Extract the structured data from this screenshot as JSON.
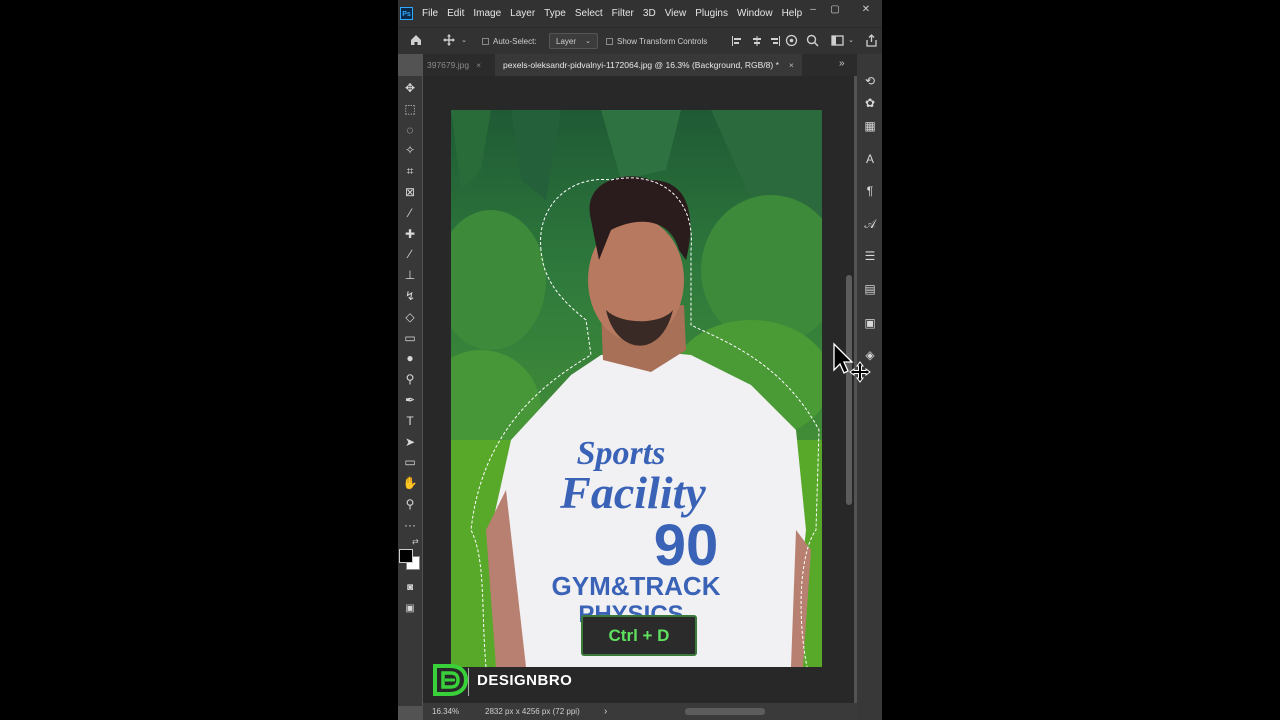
{
  "app": {
    "logo_text": "Ps",
    "menu": [
      "File",
      "Edit",
      "Image",
      "Layer",
      "Type",
      "Select",
      "Filter",
      "3D",
      "View",
      "Plugins",
      "Window",
      "Help"
    ],
    "window_controls": {
      "minimize": "–",
      "restore": "▢",
      "close": "✕"
    }
  },
  "options_bar": {
    "auto_select_label": "Auto-Select:",
    "auto_select_checked": false,
    "target_value": "Layer",
    "show_transform_label": "Show Transform Controls",
    "show_transform_checked": false
  },
  "tabs": [
    {
      "label": "397679.jpg",
      "close": "×",
      "active": false
    },
    {
      "label": "pexels-oleksandr-pidvalnyi-1172064.jpg @ 16.3% (Background, RGB/8) *",
      "close": "×",
      "active": true
    }
  ],
  "tabs_overflow": "»",
  "toolbar": {
    "tools": [
      {
        "name": "move-tool-icon",
        "glyph": "✥"
      },
      {
        "name": "marquee-tool-icon",
        "glyph": "⬚"
      },
      {
        "name": "lasso-tool-icon",
        "glyph": "◌"
      },
      {
        "name": "magic-wand-tool-icon",
        "glyph": "✧"
      },
      {
        "name": "crop-tool-icon",
        "glyph": "⌗"
      },
      {
        "name": "frame-tool-icon",
        "glyph": "⊠"
      },
      {
        "name": "eyedropper-tool-icon",
        "glyph": "⁄"
      },
      {
        "name": "healing-brush-tool-icon",
        "glyph": "✚"
      },
      {
        "name": "brush-tool-icon",
        "glyph": "∕"
      },
      {
        "name": "clone-stamp-tool-icon",
        "glyph": "⊥"
      },
      {
        "name": "history-brush-tool-icon",
        "glyph": "↯"
      },
      {
        "name": "eraser-tool-icon",
        "glyph": "◇"
      },
      {
        "name": "gradient-tool-icon",
        "glyph": "▭"
      },
      {
        "name": "blur-tool-icon",
        "glyph": "●"
      },
      {
        "name": "dodge-tool-icon",
        "glyph": "⚲"
      },
      {
        "name": "pen-tool-icon",
        "glyph": "✒"
      },
      {
        "name": "type-tool-icon",
        "glyph": "T"
      },
      {
        "name": "path-selection-tool-icon",
        "glyph": "➤"
      },
      {
        "name": "rectangle-tool-icon",
        "glyph": "▭"
      },
      {
        "name": "hand-tool-icon",
        "glyph": "✋"
      },
      {
        "name": "zoom-tool-icon",
        "glyph": "⚲"
      },
      {
        "name": "more-tools-icon",
        "glyph": "···"
      }
    ],
    "extra": [
      {
        "name": "quick-mask-icon",
        "glyph": "◙"
      },
      {
        "name": "screen-mode-icon",
        "glyph": "▣"
      }
    ]
  },
  "right_panel": {
    "icons": [
      {
        "name": "history-panel-icon",
        "glyph": "⟲"
      },
      {
        "name": "color-panel-icon",
        "glyph": "✿"
      },
      {
        "name": "swatches-panel-icon",
        "glyph": "▦"
      },
      {
        "name": "character-panel-icon",
        "glyph": "A"
      },
      {
        "name": "paragraph-panel-icon",
        "glyph": "¶"
      },
      {
        "name": "glyphs-panel-icon",
        "glyph": "𝒜"
      },
      {
        "name": "adjustments-panel-icon",
        "glyph": "☰"
      },
      {
        "name": "libraries-panel-icon",
        "glyph": "▤"
      },
      {
        "name": "properties-panel-icon",
        "glyph": "▣"
      },
      {
        "name": "layers-panel-icon",
        "glyph": "◈"
      }
    ]
  },
  "canvas": {
    "image_alt": "pexels-oleksandr-pidvalnyi-1172064.jpg",
    "shirt_line1": "Sports",
    "shirt_line2": "Facility",
    "shirt_number": "90",
    "shirt_line3": "GYM&TRACK",
    "shirt_line4": "PHYSICS"
  },
  "status_bar": {
    "zoom": "16.34%",
    "doc_info": "2832 px x 4256 px (72 ppi)",
    "arrow": "›"
  },
  "overlay": {
    "shortcut": "Ctrl + D",
    "brand": "DESIGNBRO"
  },
  "colors": {
    "ui_dark": "#323232",
    "panel": "#383838",
    "canvas_bg": "#282828",
    "accent_green": "#5fe05f",
    "ps_blue": "#31a8ff",
    "shirt_blue": "#3a63b8"
  }
}
